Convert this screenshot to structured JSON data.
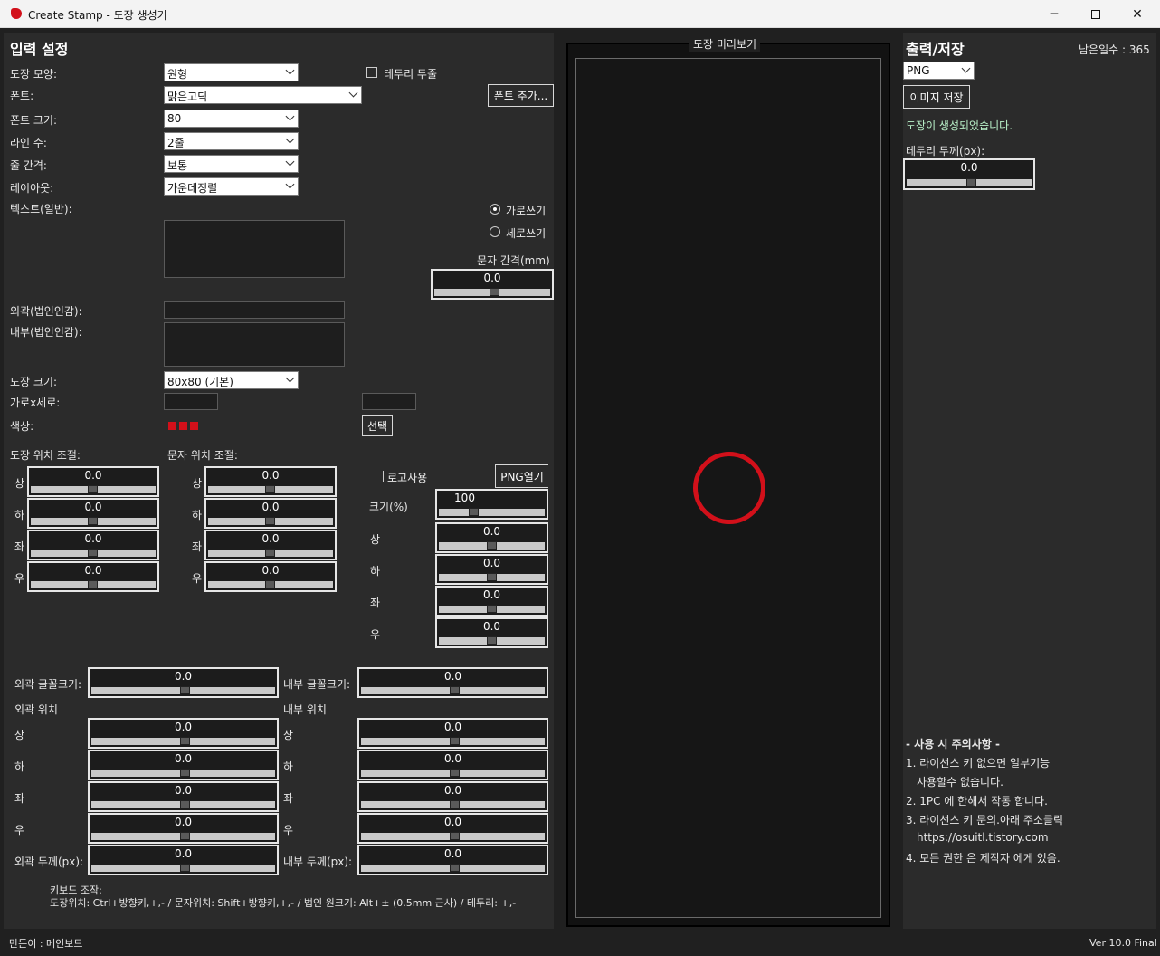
{
  "window": {
    "title": "Create Stamp - 도장 생성기"
  },
  "left": {
    "header": "입력 설정",
    "shape": {
      "label": "도장 모양:",
      "value": "원형"
    },
    "border_emboss": {
      "label": "테두리 두줄"
    },
    "font": {
      "label": "폰트:",
      "value": "맑은고딕"
    },
    "font_add_button": "폰트 추가...",
    "font_size": {
      "label": "폰트 크기:",
      "value": "80"
    },
    "lines": {
      "label": "라인 수:",
      "value": "2줄"
    },
    "line_spacing": {
      "label": "줄 간격:",
      "value": "보통"
    },
    "layout": {
      "label": "레이아웃:",
      "value": "가운데정렬"
    },
    "text_normal_label": "텍스트(일반):",
    "horizontal": "가로쓰기",
    "vertical": "세로쓰기",
    "char_spacing_label": "문자 간격(mm)",
    "char_spacing_value": "0.0",
    "outer_label": "외곽(법인인감):",
    "inner_label": "내부(법인인감):",
    "stamp_size": {
      "label": "도장 크기:",
      "value": "80x80 (기본)"
    },
    "wh_label": "가로x세로:",
    "color_label": "색상:",
    "select_button": "선택",
    "stamp_pos_label": "도장 위치 조절:",
    "char_pos_label": "문자 위치 조절:",
    "dir_labels": [
      "상",
      "하",
      "좌",
      "우"
    ],
    "stamp_pos_values": [
      "0.0",
      "0.0",
      "0.0",
      "0.0"
    ],
    "char_pos_values": [
      "0.0",
      "0.0",
      "0.0",
      "0.0"
    ],
    "logo_use": "로고사용",
    "png_open": "PNG열기",
    "logo_size_label": "크기(%)",
    "logo_size_value": "100",
    "logo_pos_values": [
      "0.0",
      "0.0",
      "0.0",
      "0.0"
    ],
    "outer_font_size_label": "외곽 글꼴크기:",
    "outer_font_size_value": "0.0",
    "inner_font_size_label": "내부 글꼴크기:",
    "inner_font_size_value": "0.0",
    "outer_pos_label": "외곽 위치",
    "inner_pos_label": "내부 위치",
    "outer_pos_values": [
      "0.0",
      "0.0",
      "0.0",
      "0.0"
    ],
    "inner_pos_values": [
      "0.0",
      "0.0",
      "0.0",
      "0.0"
    ],
    "outer_thick_label": "외곽 두께(px):",
    "outer_thick_value": "0.0",
    "inner_thick_label": "내부 두께(px):",
    "inner_thick_value": "0.0",
    "keyboard_title": "키보드 조작:",
    "keyboard_desc": "도장위치: Ctrl+방향키,+,- / 문자위치: Shift+방향키,+,- / 법인 원크기: Alt+± (0.5mm 근사) / 테두리: +,-"
  },
  "preview": {
    "label": "도장 미리보기",
    "stamp_color": "#d2101a"
  },
  "right": {
    "header": "출력/저장",
    "days_left": "남은일수 : 365",
    "format": "PNG",
    "save_button": "이미지 저장",
    "status": "도장이 생성되었습니다.",
    "border_thick_label": "테두리 두께(px):",
    "border_thick_value": "0.0",
    "notes_title": "- 사용 시 주의사항 -",
    "notes": [
      "1. 라이선스 키 없으면 일부기능",
      "사용할수 없습니다.",
      "2. 1PC 에 한해서 작동 합니다.",
      "3. 라이선스 키 문의.아래 주소클릭",
      "https://osuitl.tistory.com",
      "4. 모든 권한 은 제작자 에게 있음."
    ]
  },
  "status_bar": {
    "author": "만든이 : 메인보드",
    "version": "Ver 10.0 Final"
  },
  "colors": {
    "accent_red": "#d2101a",
    "status_green": "#b8f0c8"
  }
}
